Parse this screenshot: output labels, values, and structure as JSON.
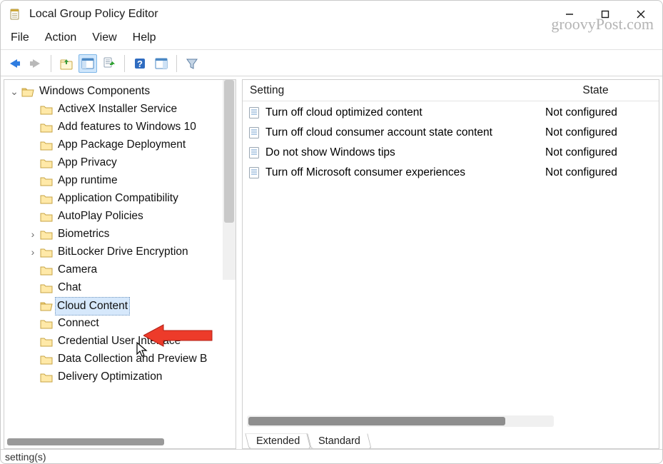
{
  "window": {
    "title": "Local Group Policy Editor"
  },
  "menu": {
    "items": [
      "File",
      "Action",
      "View",
      "Help"
    ]
  },
  "toolbar": {
    "back": "back",
    "forward": "forward",
    "up": "up",
    "properties": "properties",
    "export": "export",
    "help": "help",
    "show": "show",
    "filter": "filter"
  },
  "tree": {
    "root": {
      "label": "Windows Components",
      "expanded": true
    },
    "children": [
      {
        "label": "ActiveX Installer Service"
      },
      {
        "label": "Add features to Windows 10"
      },
      {
        "label": "App Package Deployment"
      },
      {
        "label": "App Privacy"
      },
      {
        "label": "App runtime"
      },
      {
        "label": "Application Compatibility"
      },
      {
        "label": "AutoPlay Policies"
      },
      {
        "label": "Biometrics",
        "expandable": true
      },
      {
        "label": "BitLocker Drive Encryption",
        "expandable": true
      },
      {
        "label": "Camera"
      },
      {
        "label": "Chat"
      },
      {
        "label": "Cloud Content",
        "selected": true
      },
      {
        "label": "Connect"
      },
      {
        "label": "Credential User Interface"
      },
      {
        "label": "Data Collection and Preview B"
      },
      {
        "label": "Delivery Optimization"
      }
    ]
  },
  "list": {
    "columns": {
      "setting": "Setting",
      "state": "State"
    },
    "rows": [
      {
        "setting": "Turn off cloud optimized content",
        "state": "Not configured"
      },
      {
        "setting": "Turn off cloud consumer account state content",
        "state": "Not configured"
      },
      {
        "setting": "Do not show Windows tips",
        "state": "Not configured"
      },
      {
        "setting": "Turn off Microsoft consumer experiences",
        "state": "Not configured"
      }
    ],
    "tabs": {
      "extended": "Extended",
      "standard": "Standard"
    }
  },
  "status": "setting(s)",
  "watermark": "groovyPost.com"
}
